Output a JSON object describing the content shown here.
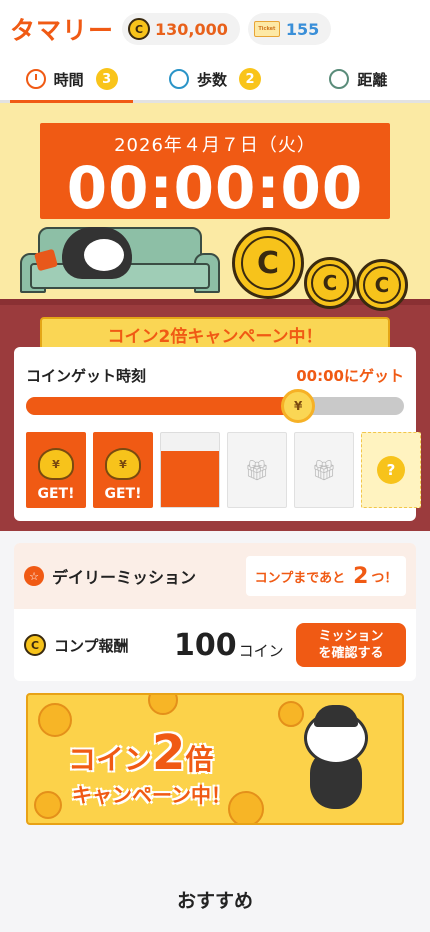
{
  "header": {
    "logo": "タマリー",
    "coin_symbol": "C",
    "coins": "130,000",
    "ticket_icon_text": "Ticket",
    "tickets": "155"
  },
  "tabs": [
    {
      "label": "時間",
      "badge": "3",
      "icon": "clock-icon",
      "active": true
    },
    {
      "label": "歩数",
      "badge": "2",
      "icon": "footprint-icon",
      "active": false
    },
    {
      "label": "距離",
      "badge": "",
      "icon": "car-icon",
      "active": false
    }
  ],
  "hero": {
    "date": "2026年４月７日（火）",
    "timer": "00:00:00",
    "campaign_ribbon": "コイン2倍キャンペーン中！"
  },
  "coin_get": {
    "label": "コインゲット時刻",
    "get_time": "00:00にゲット",
    "progress": 0.72,
    "slots": [
      {
        "state": "got",
        "label": "GET!"
      },
      {
        "state": "got",
        "label": "GET!"
      },
      {
        "state": "filling",
        "label": ""
      },
      {
        "state": "empty",
        "label": ""
      },
      {
        "state": "empty",
        "label": ""
      },
      {
        "state": "mystery",
        "label": "?"
      }
    ]
  },
  "mission": {
    "title": "デイリーミッション",
    "remain_prefix": "コンプまであと",
    "remain_count": "2",
    "remain_suffix": "つ！",
    "reward_label": "コンプ報酬",
    "reward_value": "100",
    "reward_unit": "コイン",
    "confirm_button": "ミッションを確認する"
  },
  "banner": {
    "line1_a": "コイン",
    "line1_b": "2",
    "line1_c": "倍",
    "line2": "キャンペーン中！"
  },
  "recommend": "おすすめ",
  "colors": {
    "accent": "#f05a14",
    "coin": "#f7c31b",
    "ticket_text": "#3a8fd8"
  }
}
